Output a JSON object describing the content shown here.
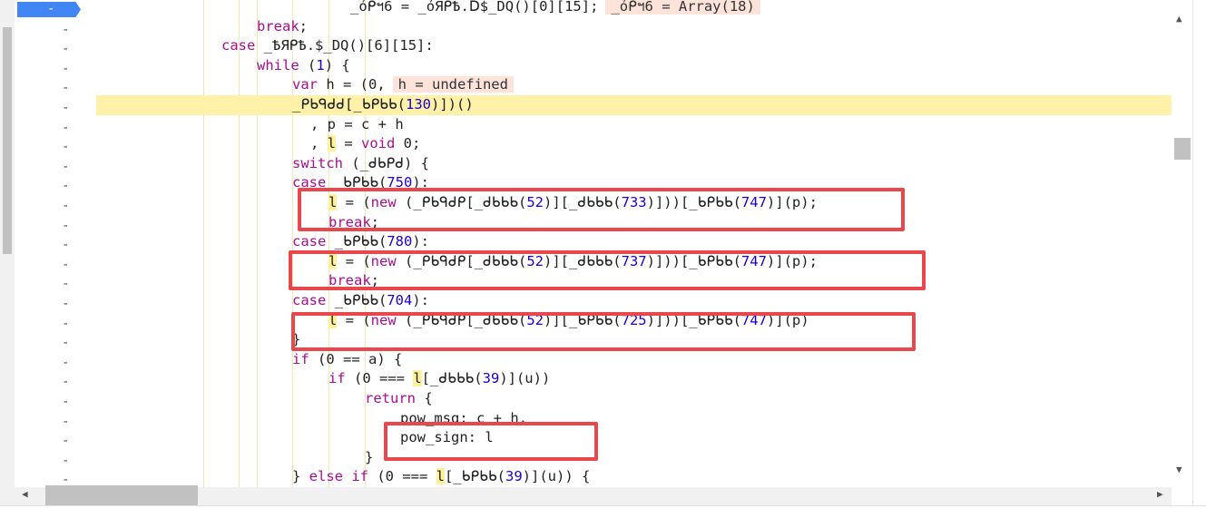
{
  "gutter": {
    "marker": "-"
  },
  "icons": {
    "scroll_up": "▲",
    "scroll_down": "▼",
    "scroll_left": "◀",
    "scroll_right": "▶"
  },
  "code_lines": [
    {
      "indent": 280,
      "text": "_ỏᑭฯ6 = _ỏЯᑭѢ.ᗞ$_DQ()[0][15];",
      "inline": "_ỏᑭฯ6 = Array(18)"
    },
    {
      "indent": 177,
      "text": "break;"
    },
    {
      "indent": 138,
      "text": "case _ѢЯᑭѢ.$_DQ()[6][15]:"
    },
    {
      "indent": 177,
      "text": "while (1) {"
    },
    {
      "indent": 216,
      "text": "var h = (0,",
      "inline": "h = undefined"
    },
    {
      "indent": 216,
      "text": "_ᑭᑲᑫᑯᑯ[_ᑲᑭᑲᑲ(130)])()",
      "highlight": true
    },
    {
      "indent": 236,
      "text": ", p = c + h"
    },
    {
      "indent": 236,
      "text": ", l = void 0;"
    },
    {
      "indent": 216,
      "text": "switch (_ᑯᑲᑭᑯ) {"
    },
    {
      "indent": 216,
      "text": "case _ᑲᑭᑲᑲ(750):"
    },
    {
      "indent": 256,
      "text": "l = (new (_ᑭᑲᑫᑯᑭ[_ᑯᑲᑲᑲ(52)][_ᑯᑲᑲᑲ(733)]))[_ᑲᑭᑲᑲ(747)](p);"
    },
    {
      "indent": 256,
      "text": "break;"
    },
    {
      "indent": 216,
      "text": "case _ᑲᑭᑲᑲ(780):"
    },
    {
      "indent": 256,
      "text": "l = (new (_ᑭᑲᑫᑯᑭ[_ᑯᑲᑲᑲ(52)][_ᑯᑲᑲᑲ(737)]))[_ᑲᑭᑲᑲ(747)](p);"
    },
    {
      "indent": 256,
      "text": "break;"
    },
    {
      "indent": 216,
      "text": "case _ᑲᑭᑲᑲ(704):"
    },
    {
      "indent": 256,
      "text": "l = (new (_ᑭᑲᑫᑯᑭ[_ᑯᑲᑲᑲ(52)][_ᑲᑭᑲᑲ(725)]))[_ᑲᑭᑲᑲ(747)](p)"
    },
    {
      "indent": 216,
      "text": "}"
    },
    {
      "indent": 216,
      "text": "if (0 == a) {"
    },
    {
      "indent": 256,
      "text": "if (0 === l[_ᑯᑲᑲᑲ(39)](u))"
    },
    {
      "indent": 296,
      "text": "return {"
    },
    {
      "indent": 335,
      "text": "pow_msg: c + h,"
    },
    {
      "indent": 335,
      "text": "pow_sign: l"
    },
    {
      "indent": 296,
      "text": "}"
    },
    {
      "indent": 216,
      "text": "} else if (0 === l[_ᑲᑭᑲᑲ(39)](u)) {"
    }
  ]
}
